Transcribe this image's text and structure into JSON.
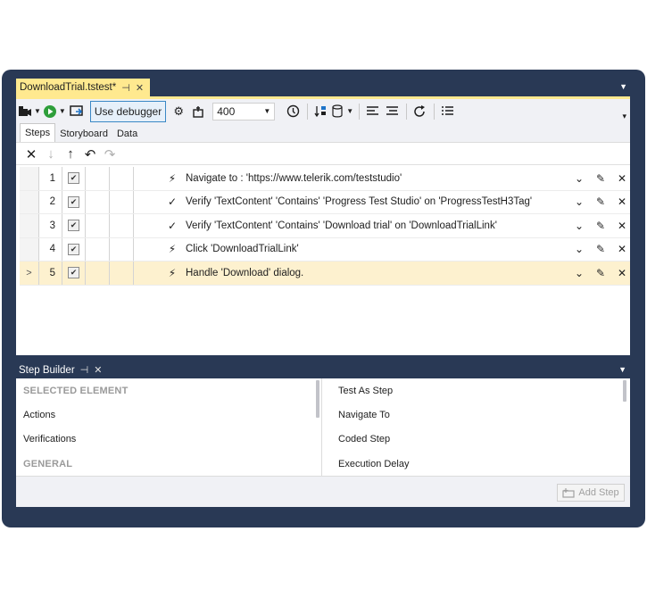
{
  "document_tab": {
    "title": "DownloadTrial.tstest*",
    "pin": "⊣",
    "close": "✕"
  },
  "toolbar": {
    "debug_label": "Use debugger",
    "zoom_value": "400"
  },
  "tabs": [
    {
      "label": "Steps"
    },
    {
      "label": "Storyboard"
    },
    {
      "label": "Data"
    }
  ],
  "steps": [
    {
      "num": "1",
      "icon": "⚡",
      "text": "Navigate to : 'https://www.telerik.com/teststudio'"
    },
    {
      "num": "2",
      "icon": "✓",
      "text": "Verify 'TextContent' 'Contains' 'Progress Test Studio' on 'ProgressTestH3Tag'"
    },
    {
      "num": "3",
      "icon": "✓",
      "text": "Verify 'TextContent' 'Contains' 'Download trial' on 'DownloadTrialLink'"
    },
    {
      "num": "4",
      "icon": "⚡",
      "text": "Click 'DownloadTrialLink'"
    },
    {
      "num": "5",
      "icon": "⚡",
      "text": "Handle 'Download' dialog."
    }
  ],
  "selected_row_marker": ">",
  "step_builder": {
    "title": "Step Builder",
    "left_items": [
      {
        "label": "SELECTED ELEMENT",
        "heading": true
      },
      {
        "label": "Actions",
        "heading": false
      },
      {
        "label": "Verifications",
        "heading": false
      },
      {
        "label": "GENERAL",
        "heading": true
      }
    ],
    "right_items": [
      {
        "label": "Test As Step"
      },
      {
        "label": "Navigate To"
      },
      {
        "label": "Coded Step"
      },
      {
        "label": "Execution Delay"
      }
    ],
    "add_step_label": "Add Step"
  },
  "colors": {
    "frame": "#293955",
    "active_tab": "#ffe98f",
    "selected_row": "#fdf1cf",
    "debug_border": "#3a88c5"
  }
}
